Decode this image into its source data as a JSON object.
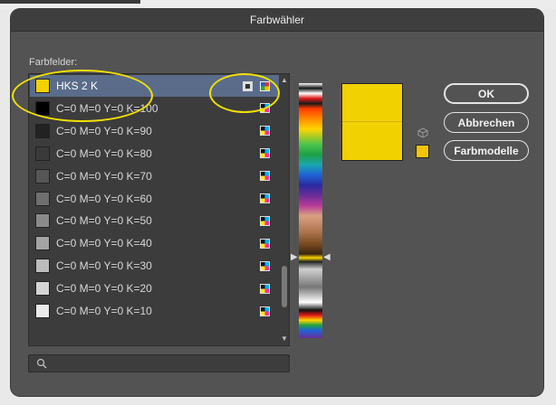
{
  "dialog": {
    "title": "Farbwähler",
    "swatches_label": "Farbfelder:"
  },
  "swatches": [
    {
      "name": "HKS 2 K",
      "color": "#f2d100",
      "type": "spot",
      "selected": true
    },
    {
      "name": "C=0 M=0 Y=0 K=100",
      "color": "#000000",
      "type": "process",
      "selected": false
    },
    {
      "name": "C=0 M=0 Y=0 K=90",
      "color": "#222222",
      "type": "process",
      "selected": false
    },
    {
      "name": "C=0 M=0 Y=0 K=80",
      "color": "#3a3a3a",
      "type": "process",
      "selected": false
    },
    {
      "name": "C=0 M=0 Y=0 K=70",
      "color": "#565656",
      "type": "process",
      "selected": false
    },
    {
      "name": "C=0 M=0 Y=0 K=60",
      "color": "#6f6f6f",
      "type": "process",
      "selected": false
    },
    {
      "name": "C=0 M=0 Y=0 K=50",
      "color": "#8a8a8a",
      "type": "process",
      "selected": false
    },
    {
      "name": "C=0 M=0 Y=0 K=40",
      "color": "#a4a4a4",
      "type": "process",
      "selected": false
    },
    {
      "name": "C=0 M=0 Y=0 K=30",
      "color": "#bcbcbc",
      "type": "process",
      "selected": false
    },
    {
      "name": "C=0 M=0 Y=0 K=20",
      "color": "#d4d4d4",
      "type": "process",
      "selected": false
    },
    {
      "name": "C=0 M=0 Y=0 K=10",
      "color": "#eaeaea",
      "type": "process",
      "selected": false
    }
  ],
  "preview": {
    "new_color": "#f2d100",
    "original_color": "#f2d100",
    "gamut_swatch_color": "#f5c400"
  },
  "buttons": {
    "ok": "OK",
    "cancel": "Abbrechen",
    "color_models": "Farbmodelle"
  },
  "colors": {
    "dialog_bg": "#535353",
    "selection": "#5a6c8a",
    "highlight": "#f2e100"
  }
}
